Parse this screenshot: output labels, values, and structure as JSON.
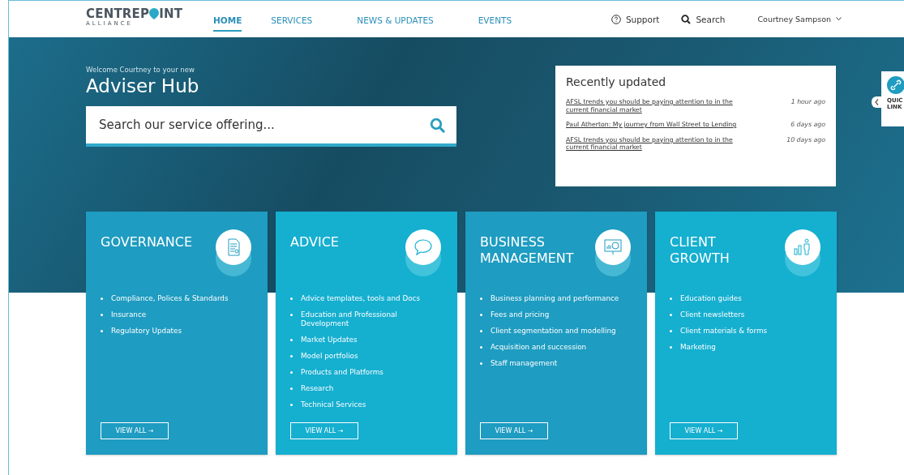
{
  "logo": {
    "name_start": "CENTREP",
    "name_end": "INT",
    "tagline": "ALLIANCE"
  },
  "nav": [
    {
      "label": "HOME",
      "selected": true
    },
    {
      "label": "SERVICES",
      "selected": false
    },
    {
      "label": "NEWS & UPDATES",
      "selected": false
    },
    {
      "label": "EVENTS",
      "selected": false
    }
  ],
  "support": "Support",
  "search": "Search",
  "user": "Courtney Sampson",
  "hero": {
    "welcome": "Welcome Courtney to your new",
    "title": "Adviser Hub",
    "search_placeholder": "Search our service offering..."
  },
  "recently_updated": {
    "title": "Recently updated",
    "items": [
      {
        "title": "AFSL trends you should be paying attention to in the current financial market",
        "time": "1 hour ago"
      },
      {
        "title": "Paul Atherton: My journey from Wall Street to Lending",
        "time": "6 days ago"
      },
      {
        "title": "AFSL trends you should be paying attention to in the current financial market",
        "time": "10 days ago"
      }
    ]
  },
  "quick_links": {
    "line_1": "QUIC",
    "line_2": "LINK"
  },
  "cards": [
    {
      "kind": "document",
      "title": "GOVERNANCE",
      "color": "#1e9cc1",
      "items": [
        "Compliance, Polices & Standards",
        "Insurance",
        "Regulatory Updates"
      ],
      "button": "VIEW ALL →"
    },
    {
      "kind": "chat",
      "title": "ADVICE",
      "color": "#15afd0",
      "items": [
        "Advice templates, tools and Docs",
        "Education and Professional Development",
        "Market Updates",
        "Model portfolios",
        "Products and Platforms",
        "Research",
        "Technical Services"
      ],
      "button": "VIEW ALL →"
    },
    {
      "kind": "presentation",
      "title": "BUSINESS MANAGEMENT",
      "color": "#1e9cc1",
      "items": [
        "Business planning and performance",
        "Fees and pricing",
        "Client segmentation and modelling",
        "Acquisition and succession",
        "Staff management"
      ],
      "button": "VIEW ALL →"
    },
    {
      "kind": "growth",
      "title": "CLIENT GROWTH",
      "color": "#15afd0",
      "items": [
        "Education guides",
        "Client newsletters",
        "Client materials & forms",
        "Marketing"
      ],
      "button": "VIEW ALL →"
    }
  ]
}
